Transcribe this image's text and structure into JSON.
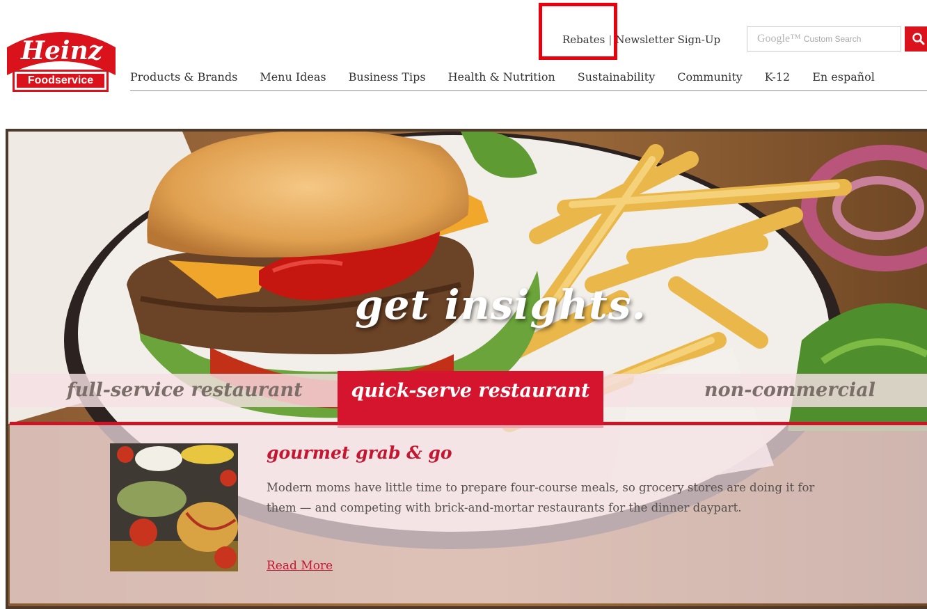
{
  "brand": {
    "logo_word": "Heinz",
    "logo_sub": "Foodservice",
    "color": "#d9121b"
  },
  "utility": {
    "rebates": "Rebates",
    "separator": "|",
    "newsletter": "Newsletter Sign-Up"
  },
  "search": {
    "google_label": "Google™",
    "placeholder": "Custom Search"
  },
  "nav": {
    "items": [
      "Products & Brands",
      "Menu Ideas",
      "Business Tips",
      "Health & Nutrition",
      "Sustainability",
      "Community",
      "K-12",
      "En español"
    ]
  },
  "hero": {
    "tagline": "get insights.",
    "tabs": {
      "full_service": "full-service restaurant",
      "quick_serve": "quick-serve restaurant",
      "non_commercial": "non-commercial"
    },
    "active_tab": "quick-serve restaurant"
  },
  "article": {
    "title": "gourmet grab & go",
    "body": "Modern moms have little time to prepare four-course meals, so grocery stores are doing it for them — and competing with brick-and-mortar restaurants for the dinner daypart.",
    "link": "Read More"
  },
  "colors": {
    "accent_red": "#d5152e",
    "highlight_box": "#e8000f"
  }
}
